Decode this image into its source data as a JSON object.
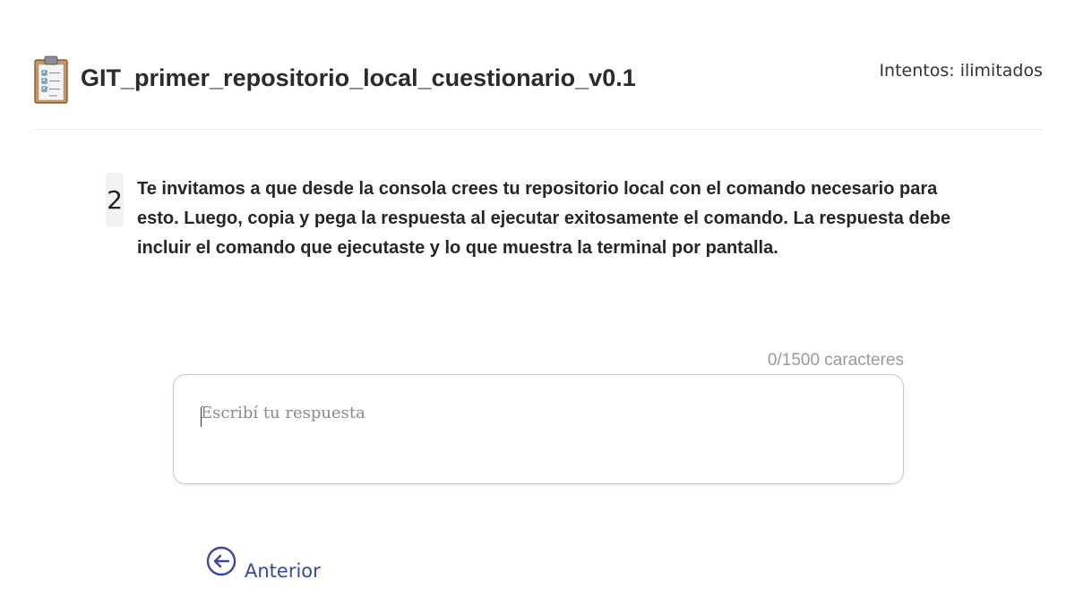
{
  "header": {
    "title": "GIT_primer_repositorio_local_cuestionario_v0.1",
    "attempts": "Intentos: ilimitados",
    "icon": "clipboard-checklist-icon"
  },
  "question": {
    "number": "2",
    "text": "Te invitamos a que desde la consola crees tu repositorio local con el comando necesario para esto. Luego, copia y pega la respuesta al ejecutar exitosamente el comando. La respuesta debe incluir el comando que ejecutaste y lo que muestra la terminal por pantalla."
  },
  "answer": {
    "char_count": "0/1500 caracteres",
    "value": "",
    "placeholder": "Escribí tu respuesta"
  },
  "navigation": {
    "prev_label": "Anterior",
    "prev_icon": "arrow-left-circle-icon",
    "accent_color": "#3d45a3"
  }
}
